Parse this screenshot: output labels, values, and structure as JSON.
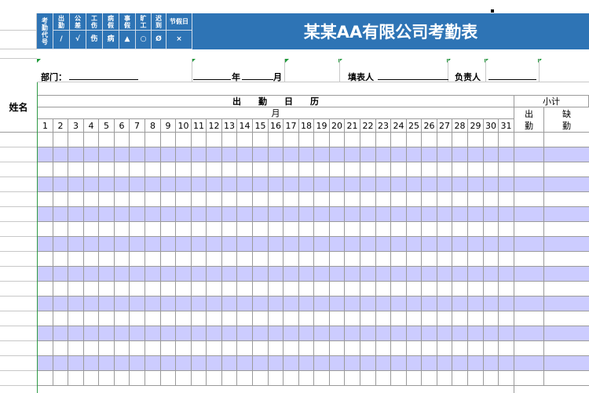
{
  "title": "某某AA有限公司考勤表",
  "legend": [
    {
      "name": "考勤代号",
      "symbol": ""
    },
    {
      "name": "出勤",
      "symbol": "/"
    },
    {
      "name": "公差",
      "symbol": "√"
    },
    {
      "name": "工伤",
      "symbol": "伤"
    },
    {
      "name": "病假",
      "symbol": "病"
    },
    {
      "name": "事假",
      "symbol": "▲"
    },
    {
      "name": "旷工",
      "symbol": "○"
    },
    {
      "name": "迟到",
      "symbol": "Ø"
    },
    {
      "name": "节假日",
      "symbol": "×"
    }
  ],
  "info": {
    "department_label": "部门：",
    "year_label": "年",
    "month_label": "月",
    "filler_label": "填表人",
    "manager_label": "负责人"
  },
  "header": {
    "name_label": "姓名",
    "calendar_label": "出　　勤　　日　　历",
    "month_label": "月",
    "days": [
      "1",
      "2",
      "3",
      "4",
      "5",
      "6",
      "7",
      "8",
      "9",
      "10",
      "11",
      "12",
      "13",
      "14",
      "15",
      "16",
      "17",
      "18",
      "19",
      "20",
      "21",
      "22",
      "23",
      "24",
      "25",
      "26",
      "27",
      "28",
      "29",
      "30",
      "31"
    ],
    "subtotal_label": "小计",
    "attendance_label": "出\n勤",
    "absence_label": "缺\n勤"
  },
  "colors": {
    "banner": "#2e74b5",
    "stripe": "#ccccff",
    "grid": "#9a9a9a"
  },
  "body_rows": 17
}
